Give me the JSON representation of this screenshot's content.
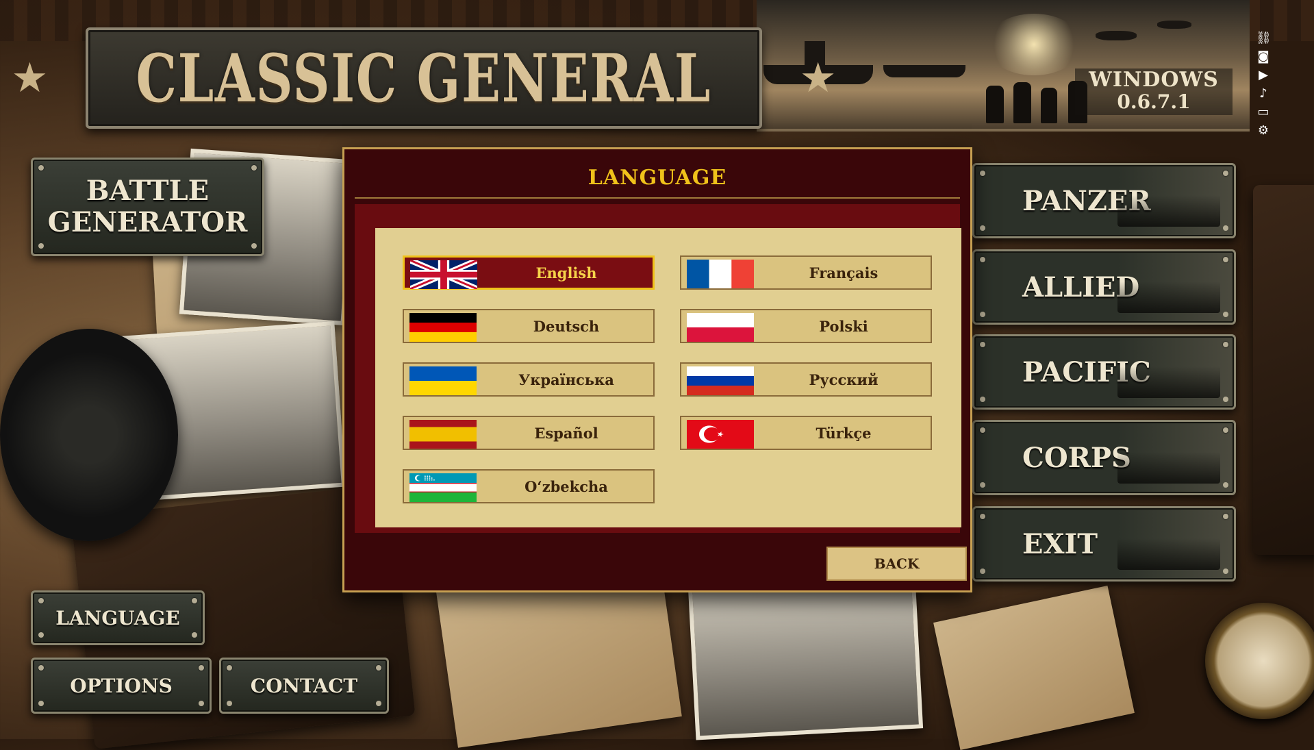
{
  "app": {
    "title": "CLASSIC GENERAL",
    "version_platform": "WINDOWS",
    "version_number": "0.6.7.1"
  },
  "toolbar": {
    "icons": [
      "link-icon",
      "camera-icon",
      "video-icon",
      "microphone-icon",
      "window-icon",
      "gear-icon"
    ]
  },
  "left_menu": {
    "battle_generator_line1": "BATTLE",
    "battle_generator_line2": "GENERATOR",
    "language": "LANGUAGE",
    "options": "OPTIONS",
    "contact": "CONTACT"
  },
  "campaigns": {
    "panzer": "PANZER",
    "allied": "ALLIED",
    "pacific": "PACIFIC",
    "corps": "CORPS",
    "exit": "EXIT"
  },
  "dialog": {
    "title": "LANGUAGE",
    "back": "BACK",
    "selected": "English",
    "languages": [
      {
        "label": "English",
        "flag": "uk-flag-icon"
      },
      {
        "label": "Français",
        "flag": "france-flag-icon"
      },
      {
        "label": "Deutsch",
        "flag": "germany-flag-icon"
      },
      {
        "label": "Polski",
        "flag": "poland-flag-icon"
      },
      {
        "label": "Українська",
        "flag": "ukraine-flag-icon"
      },
      {
        "label": "Русский",
        "flag": "russia-flag-icon"
      },
      {
        "label": "Español",
        "flag": "spain-flag-icon"
      },
      {
        "label": "Türkçe",
        "flag": "turkey-flag-icon"
      },
      {
        "label": "O‘zbekcha",
        "flag": "uzbekistan-flag-icon"
      }
    ]
  },
  "colors": {
    "dialog_bg": "#3a0609",
    "dialog_body": "#690c10",
    "panel": "#e1cf91",
    "button": "#dac37f",
    "selected": "#7a0d12",
    "accent_gold": "#f0c21a"
  }
}
